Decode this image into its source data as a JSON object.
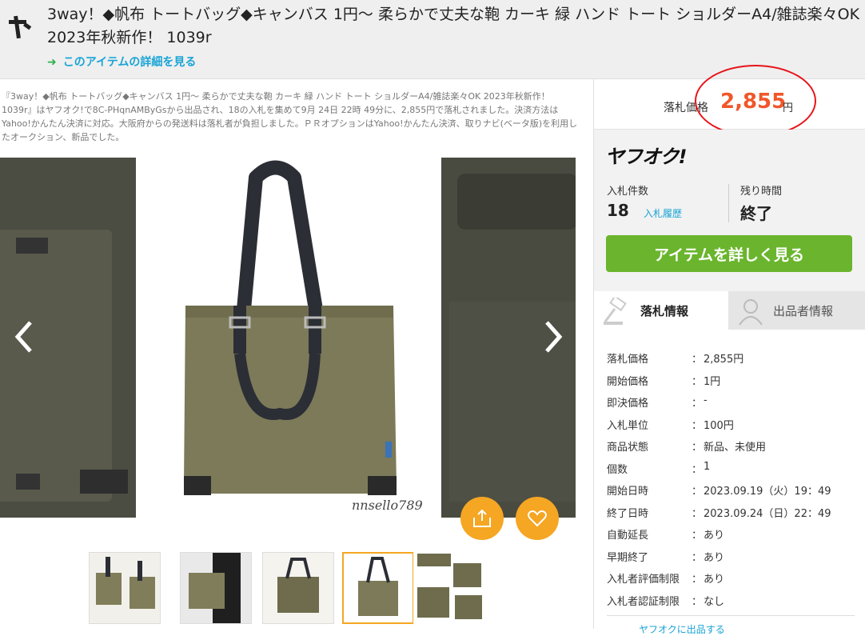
{
  "header": {
    "title": "3way！◆帆布 トートバッグ◆キャンバス 1円～ 柔らかで丈夫な鞄 カーキ 緑 ハンド トート ショルダーA4/雑誌楽々OK 2023年秋新作！ 1039r",
    "detail_link": "このアイテムの詳細を見る",
    "logo_icon": "ya-logo-icon"
  },
  "description": "『3way！◆帆布 トートバッグ◆キャンバス 1円～ 柔らかで丈夫な鞄 カーキ 緑 ハンド トート ショルダーA4/雑誌楽々OK 2023年秋新作！ 1039r』はヤフオク!で8C-PHqnAMByGsから出品され、18の入札を集めて9月 24日 22時 49分に、2,855円で落札されました。決済方法はYahoo!かんたん決済に対応。大阪府からの発送料は落札者が負担しました。ＰＲオプションはYahoo!かんたん決済、取りナビ(ベータ版)を利用したオークション、新品でした。",
  "gallery": {
    "watermark": "nnsello789",
    "prev_icon": "chevron-left-icon",
    "next_icon": "chevron-right-icon"
  },
  "price": {
    "label": "落札価格",
    "value": "2,855",
    "unit": "円"
  },
  "auction": {
    "logo": "ヤフオク!",
    "bids_label": "入札件数",
    "bids_count": "18",
    "bid_history": "入札履歴",
    "remaining_label": "残り時間",
    "remaining_value": "終了",
    "detail_button": "アイテムを詳しく見る"
  },
  "tabs": [
    {
      "label": "落札情報",
      "active": true
    },
    {
      "label": "出品者情報",
      "active": false
    }
  ],
  "info": [
    {
      "k": "落札価格",
      "v": "2,855円"
    },
    {
      "k": "開始価格",
      "v": "1円"
    },
    {
      "k": "即決価格",
      "v": "-"
    },
    {
      "k": "入札単位",
      "v": "100円"
    },
    {
      "k": "商品状態",
      "v": "新品、未使用"
    },
    {
      "k": "個数",
      "v": "1"
    },
    {
      "k": "開始日時",
      "v": "2023.09.19（火）19：49"
    },
    {
      "k": "終了日時",
      "v": "2023.09.24（日）22：49"
    },
    {
      "k": "自動延長",
      "v": "あり"
    },
    {
      "k": "早期終了",
      "v": "あり"
    },
    {
      "k": "入札者評価制限",
      "v": "あり"
    },
    {
      "k": "入札者認証制限",
      "v": "なし"
    }
  ],
  "separator": "：",
  "bottom_link": "ヤフオクに出品する",
  "colors": {
    "accent_orange": "#f0572a",
    "button_green": "#6ab52d",
    "link_blue": "#18a4d6",
    "fab_orange": "#f5a623"
  }
}
